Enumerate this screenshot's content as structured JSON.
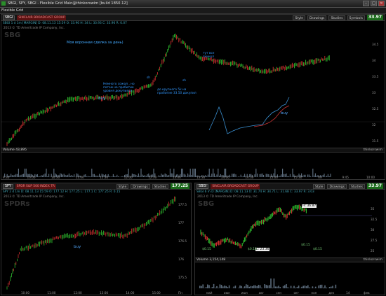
{
  "window": {
    "title": "SBGI, SPY, SBGI - Flexible Grid Main@thinkorswim [build 1850.12]",
    "controls": [
      "–",
      "□",
      "✕"
    ]
  },
  "menu": {
    "title": "Flexible Grid"
  },
  "top_panel": {
    "symbol": "SBGI",
    "description": "SINCLAIR BROADCAST GROUP CL A",
    "buttons": {
      "style": "Style",
      "drawings": "Drawings",
      "studies": "Studies",
      "symbols": "Symbols"
    },
    "price": "33.97",
    "quote_line": "SBGI 1 d 1m [MARGIN]  D: 08.11.13 15:59  O: 33.96  H: 34  L: 33.93  C: 33.96  R: 0.07",
    "copyright": "2013 © TD Ameritrade IP Company, Inc.",
    "watermark": "SBG",
    "annotations": [
      "Моя воронная сделка за день)",
      "Немного сожал , но потом на пробитие уровня докупился",
      "buy",
      "sh",
      "до крупного 5k на пробитие 33.50 докупил",
      "sh",
      "тут все скинул"
    ],
    "volume_label": "Volume",
    "volume_value": "43,895",
    "volume_right": "thinkorswim",
    "right_axis": [
      "34.5",
      "34",
      "33.5",
      "33",
      "32.5",
      "32",
      "31.5"
    ],
    "time_axis": [
      "9:30",
      "10:00",
      "10:30",
      "11:00",
      "11:30",
      "12:00",
      "12:30",
      "13:00",
      "13:30",
      "14:00",
      "14:30",
      "15:00",
      "15:30",
      "Пн",
      "9:45",
      "10:00"
    ]
  },
  "left_panel": {
    "symbol": "SPY",
    "description": "SPDR S&P 500 INDEX TR",
    "buttons": {
      "style": "Style",
      "drawings": "Drawings",
      "studies": "Studies"
    },
    "price": "177.25",
    "quote_line": "SPY 2 d 1m  D: 08.11.13 15:59  O: 177.12  H: 177.25  L: 177.1  C: 177.25  R: 0.15",
    "copyright": "2013 © TD Ameritrade IP Company, Inc.",
    "watermark": "SPDRs",
    "buy_label": "buy",
    "right_axis": [
      "177.5",
      "177",
      "176.5",
      "176",
      "175.5"
    ],
    "time_axis": [
      "10:00",
      "11:00",
      "12:00",
      "13:00",
      "14:00",
      "15:00",
      "Пн"
    ]
  },
  "right_panel": {
    "symbol": "SBGI",
    "description": "SINCLAIR BROADCAST GROUP",
    "buttons": {
      "style": "Style",
      "drawings": "Drawings",
      "studies": "Studies"
    },
    "price": "33.97",
    "quote_line": "SBGI 6 m D [MARGIN]  D: 08.11.13  O: 31.74  H: 34.71  L: 31.68  C: 33.97  R: 3.03",
    "copyright": "2013 © TD Ameritrade IP Company, Inc.",
    "watermark": "SBG",
    "hi_label": "H: 36.87",
    "lo_label": "L: 23.36",
    "markers": [
      "$0.15",
      "$0.15",
      "$0.15",
      "$0.15"
    ],
    "volume_label": "Volume",
    "volume_value": "3,154,148",
    "volume_right": "thinkorswim",
    "right_axis": [
      "35",
      "32.5",
      "30",
      "27.5",
      "25",
      "22.5"
    ],
    "time_axis": [
      "май",
      "июн",
      "июл",
      "авг",
      "сен",
      "окт",
      "ноя",
      "дек",
      "14",
      "фев"
    ]
  }
}
